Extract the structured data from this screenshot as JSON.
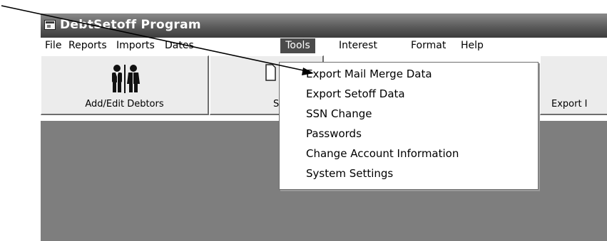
{
  "window": {
    "title": "DebtSetoff Program"
  },
  "menubar": {
    "items": [
      {
        "label": "File"
      },
      {
        "label": "Reports"
      },
      {
        "label": "Imports"
      },
      {
        "label": "Dates"
      },
      {
        "label": "Tools",
        "active": true
      },
      {
        "label": "Interest"
      },
      {
        "label": "Format"
      },
      {
        "label": "Help"
      }
    ]
  },
  "toolbar": {
    "buttons": [
      {
        "label": "Add/Edit Debtors",
        "icon": "people-icon"
      },
      {
        "label": "Sen",
        "icon": "document-icon"
      },
      {
        "label": "Export I",
        "icon": "export-icon"
      }
    ]
  },
  "tools_menu": {
    "items": [
      {
        "label": "Export Mail Merge Data"
      },
      {
        "label": "Export Setoff Data"
      },
      {
        "label": "SSN Change"
      },
      {
        "label": "Passwords"
      },
      {
        "label": "Change Account Information"
      },
      {
        "label": "System Settings"
      }
    ]
  },
  "colors": {
    "titlebar_dark": "#3c3c3c",
    "menu_highlight": "#4b4b4b",
    "workspace": "#7e7e7e",
    "button_face": "#ececec"
  }
}
